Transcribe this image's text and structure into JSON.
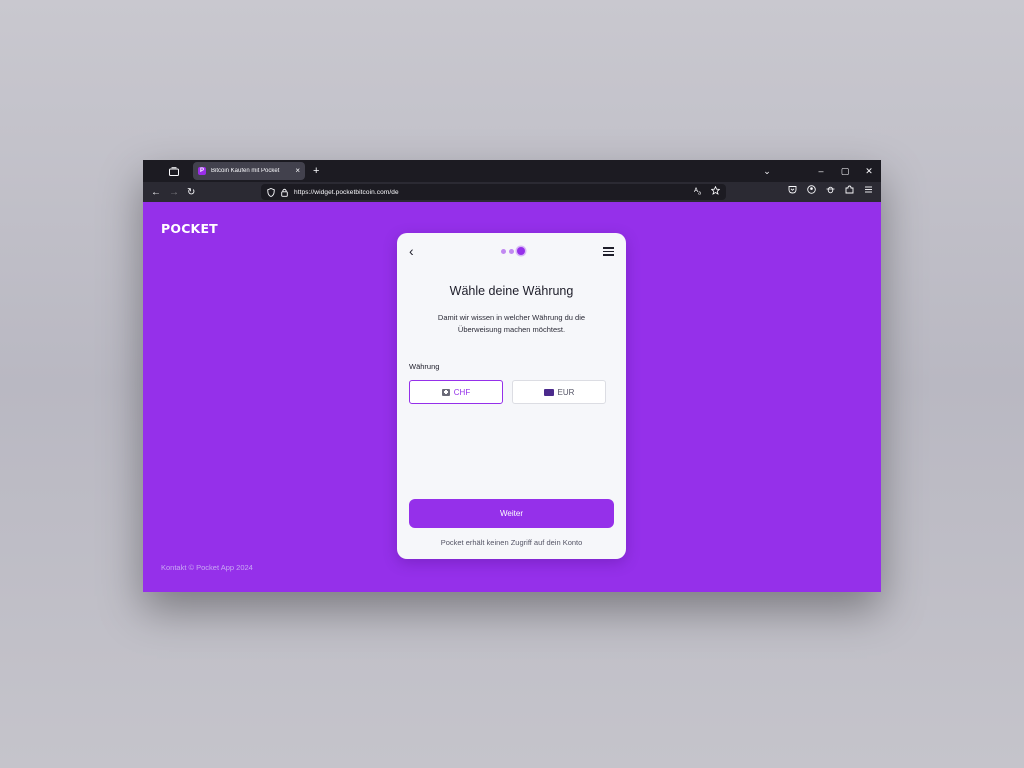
{
  "browser": {
    "tab_title": "Bitcoin Kaufen mit Pocket",
    "favicon_letter": "P",
    "tab_close": "×",
    "new_tab": "+",
    "url": "https://widget.pocketbitcoin.com/de",
    "window_controls": {
      "list": "⌄",
      "minimize": "–",
      "maximize": "▢",
      "close": "✕"
    },
    "nav": {
      "back": "←",
      "forward": "→",
      "reload": "↻"
    }
  },
  "page": {
    "logo": "POCKET",
    "footer": "Kontakt © Pocket App 2024"
  },
  "card": {
    "back_icon": "‹",
    "title": "Wähle deine Währung",
    "description": "Damit wir wissen in welcher Währung du die Überweisung machen möchtest.",
    "currency_label": "Währung",
    "currencies": [
      {
        "code": "CHF",
        "selected": true
      },
      {
        "code": "EUR",
        "selected": false
      }
    ],
    "continue_label": "Weiter",
    "note": "Pocket erhält keinen Zugriff auf dein Konto"
  },
  "colors": {
    "brand": "#9530ea",
    "browser_dark": "#1c1b22"
  }
}
